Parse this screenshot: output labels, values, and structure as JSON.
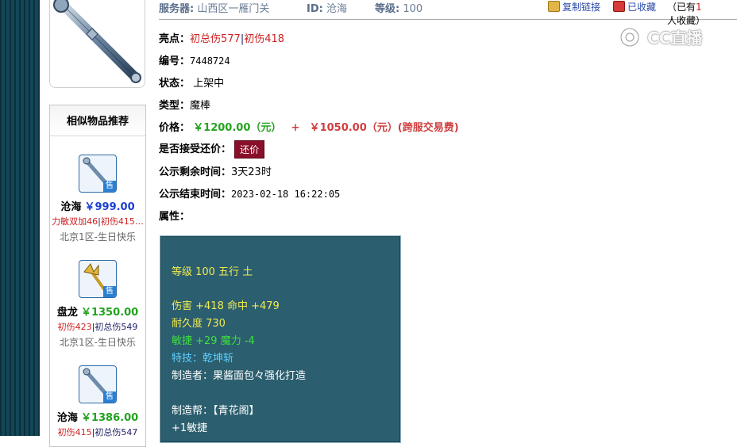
{
  "header": {
    "server_label": "服务器:",
    "server_value": "山西区一雁门关",
    "id_label": "ID:",
    "id_value": "沧海",
    "level_label": "等级:",
    "level_value": "100",
    "copy_link": "复制链接",
    "favorited": "已收藏",
    "fav_prefix": "（已有",
    "fav_count": "1",
    "fav_suffix": "人收藏）"
  },
  "watermark": "CC直播",
  "detail": {
    "highlight_label": "亮点：",
    "highlight_a": "初总伤577",
    "highlight_sep": "|",
    "highlight_b": "初伤418",
    "number_label": "编号：",
    "number_value": "7448724",
    "status_label": "状态：",
    "status_value": "上架中",
    "type_label": "类型：",
    "type_value": "魔棒",
    "price_label": "价格：",
    "price_a": "￥1200.00（元）",
    "price_plus": "+",
    "price_b": "￥1050.00（元）(跨服交易费)",
    "counter_label": "是否接受还价：",
    "counter_button": "还价",
    "remain_label": "公示剩余时间：",
    "remain_value": "3天23时",
    "end_label": "公示结束时间：",
    "end_value": "2023-02-18 16:22:05",
    "attr_label": "属性："
  },
  "attributes": {
    "line1": "等级 100 五行 土",
    "line2": "伤害 +418 命中 +479",
    "line3": "耐久度 730",
    "line4": "敏捷 +29 魔力 -4",
    "line5": "特技：乾坤斩",
    "line6": "制造者：果酱面包々强化打造",
    "line7": "制造帮：【青花阁】",
    "line8": "+1敏捷"
  },
  "similar": {
    "title": "相似物品推荐",
    "items": [
      {
        "name": "沧海",
        "price": "￥999.00",
        "attr_a": "力敏双加46",
        "sep": "|",
        "attr_b": "初伤415…",
        "server": "北京1区-生日快乐",
        "badge": "售"
      },
      {
        "name": "盘龙",
        "price": "￥1350.00",
        "attr_a": "初伤423",
        "sep": "|",
        "attr_b": "初总伤549",
        "server": "北京1区-生日快乐",
        "badge": "售"
      },
      {
        "name": "沧海",
        "price": "￥1386.00",
        "attr_a": "初伤415",
        "sep": "|",
        "attr_b": "初总伤547",
        "server": "",
        "badge": "售"
      }
    ]
  },
  "colors": {
    "page_bg": "#0f3b4b",
    "attr_box_bg": "#2b5e6e",
    "counter_button_bg": "#8a0f2a",
    "price_green": "#24a31f",
    "price_red": "#d04040"
  }
}
